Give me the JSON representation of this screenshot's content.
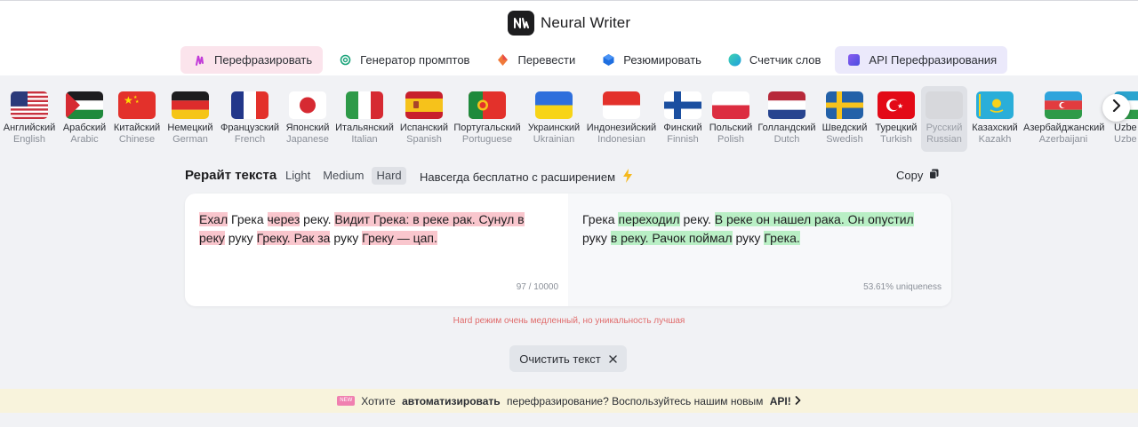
{
  "brand": {
    "name": "Neural Writer",
    "logo_icon": "neuralwriter-logo-icon"
  },
  "nav": [
    {
      "label": "Перефразировать",
      "icon": "feather-icon",
      "active": true
    },
    {
      "label": "Генератор промптов",
      "icon": "openai-icon",
      "active": false
    },
    {
      "label": "Перевести",
      "icon": "translate-diamond-icon",
      "active": false
    },
    {
      "label": "Резюмировать",
      "icon": "cube-icon",
      "active": false
    },
    {
      "label": "Счетчик слов",
      "icon": "circle-icon",
      "active": false
    },
    {
      "label": "API Перефразирования",
      "icon": "api-square-icon",
      "active": false
    }
  ],
  "languages": [
    {
      "native": "Английский",
      "english": "English",
      "flag": "us-flag-icon"
    },
    {
      "native": "Арабский",
      "english": "Arabic",
      "flag": "palestine-flag-icon"
    },
    {
      "native": "Китайский",
      "english": "Chinese",
      "flag": "china-flag-icon"
    },
    {
      "native": "Немецкий",
      "english": "German",
      "flag": "germany-flag-icon"
    },
    {
      "native": "Французский",
      "english": "French",
      "flag": "france-flag-icon"
    },
    {
      "native": "Японский",
      "english": "Japanese",
      "flag": "japan-flag-icon"
    },
    {
      "native": "Итальянский",
      "english": "Italian",
      "flag": "italy-flag-icon"
    },
    {
      "native": "Испанский",
      "english": "Spanish",
      "flag": "spain-flag-icon"
    },
    {
      "native": "Португальский",
      "english": "Portuguese",
      "flag": "portugal-flag-icon"
    },
    {
      "native": "Украинский",
      "english": "Ukrainian",
      "flag": "ukraine-flag-icon"
    },
    {
      "native": "Индонезийский",
      "english": "Indonesian",
      "flag": "indonesia-flag-icon"
    },
    {
      "native": "Финский",
      "english": "Finnish",
      "flag": "finland-flag-icon"
    },
    {
      "native": "Польский",
      "english": "Polish",
      "flag": "poland-flag-icon"
    },
    {
      "native": "Голландский",
      "english": "Dutch",
      "flag": "netherlands-flag-icon"
    },
    {
      "native": "Шведский",
      "english": "Swedish",
      "flag": "sweden-flag-icon"
    },
    {
      "native": "Турецкий",
      "english": "Turkish",
      "flag": "turkey-flag-icon"
    },
    {
      "native": "Русский",
      "english": "Russian",
      "flag": "russia-flag-icon",
      "selected": true
    },
    {
      "native": "Казахский",
      "english": "Kazakh",
      "flag": "kazakhstan-flag-icon"
    },
    {
      "native": "Азербайджанский",
      "english": "Azerbaijani",
      "flag": "azerbaijan-flag-icon"
    },
    {
      "native": "Uzbe",
      "english": "Uzbe",
      "flag": "uzbekistan-flag-icon"
    }
  ],
  "editor": {
    "title": "Рерайт текста",
    "modes": [
      {
        "label": "Light"
      },
      {
        "label": "Medium"
      },
      {
        "label": "Hard",
        "active": true
      }
    ],
    "free_extension": "Навсегда бесплатно с расширением",
    "copy_label": "Copy",
    "input_segments": [
      {
        "t": "Ехал",
        "h": true
      },
      {
        "t": " Грека ",
        "h": false
      },
      {
        "t": "через",
        "h": true
      },
      {
        "t": " реку. ",
        "h": false
      },
      {
        "t": "Видит Грека: в реке рак. Сунул в реку",
        "h": true
      },
      {
        "t": " руку ",
        "h": false
      },
      {
        "t": "Греку. Рак за",
        "h": true
      },
      {
        "t": " руку ",
        "h": false
      },
      {
        "t": "Греку — цап.",
        "h": true
      }
    ],
    "output_segments": [
      {
        "t": "Грека ",
        "h": false
      },
      {
        "t": "переходил",
        "h": true
      },
      {
        "t": " реку. ",
        "h": false
      },
      {
        "t": "В реке он нашел рака. Он опустил",
        "h": true
      },
      {
        "t": " руку ",
        "h": false
      },
      {
        "t": "в реку. Рачок поймал",
        "h": true
      },
      {
        "t": " руку ",
        "h": false
      },
      {
        "t": "Грека.",
        "h": true
      }
    ],
    "char_count": "97 / 10000",
    "uniqueness": "53.61% uniqueness",
    "hard_warning": "Hard режим очень медленный, но уникальность лучшая",
    "clear_label": "Очистить текст"
  },
  "promo": {
    "badge": "NEW",
    "prefix": "Хотите ",
    "bold1": "автоматизировать",
    "middle": " перефразирование? Воспользуйтесь нашим новым ",
    "bold2": "API!"
  },
  "colors": {
    "highlight_removed": "#f9c6cd",
    "highlight_added": "#b9efc5",
    "warning": "#e06c6c"
  }
}
